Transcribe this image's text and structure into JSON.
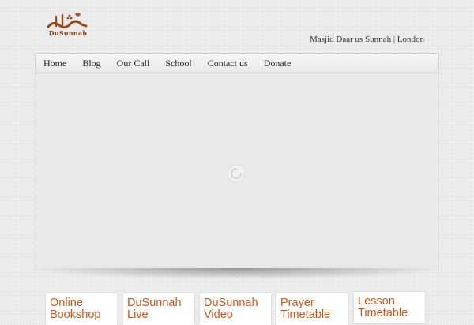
{
  "header": {
    "logo_text": "DuSunnah",
    "tagline": "Masjid Daar us Sunnah | London"
  },
  "nav": {
    "items": [
      {
        "label": "Home"
      },
      {
        "label": "Blog"
      },
      {
        "label": "Our Call"
      },
      {
        "label": "School"
      },
      {
        "label": "Contact us"
      },
      {
        "label": "Donate"
      }
    ]
  },
  "slider": {
    "loading_icon": "spinner-icon"
  },
  "features": [
    {
      "title": "Online Bookshop"
    },
    {
      "title": "DuSunnah Live"
    },
    {
      "title": "DuSunnah Video"
    },
    {
      "title": "Prayer Timetable"
    },
    {
      "title": "Lesson Timetable"
    }
  ],
  "colors": {
    "brand_brown": "#8a3d11",
    "brand_orange": "#c4581f",
    "nav_bg": "#f1f1f1",
    "page_bg": "#ececec"
  }
}
